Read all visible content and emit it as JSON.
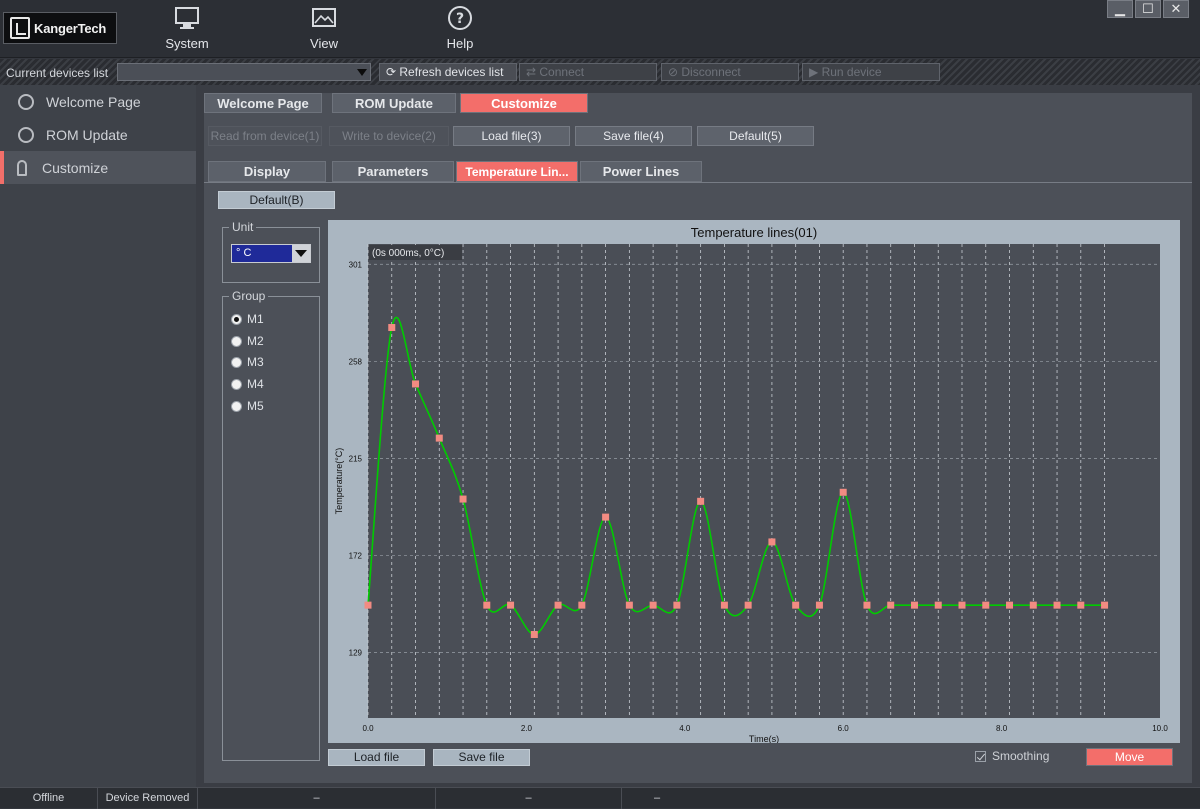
{
  "logo": {
    "text": "KangerTech"
  },
  "menu": [
    {
      "label": "System"
    },
    {
      "label": "View"
    },
    {
      "label": "Help"
    }
  ],
  "window": {
    "minimize": "▁",
    "maximize": "☐",
    "close": "✕"
  },
  "devices": {
    "label": "Current devices list",
    "selected": "",
    "refresh": "Refresh devices list",
    "connect": "Connect",
    "disconnect": "Disconnect",
    "run": "Run device"
  },
  "sidebar": {
    "items": [
      {
        "label": "Welcome Page",
        "icon": "smiley-icon"
      },
      {
        "label": "ROM Update",
        "icon": "upload-icon"
      },
      {
        "label": "Customize",
        "icon": "tool-icon"
      }
    ]
  },
  "tabs": {
    "welcome": "Welcome Page",
    "rom": "ROM Update",
    "customize": "Customize"
  },
  "toolbar": {
    "read": "Read from device(1)",
    "write": "Write to device(2)",
    "load": "Load file(3)",
    "save": "Save file(4)",
    "default": "Default(5)"
  },
  "subtabs": {
    "display": "Display",
    "parameters": "Parameters",
    "temperature": "Temperature Lin...",
    "power": "Power Lines"
  },
  "default_b": "Default(B)",
  "unit": {
    "title": "Unit",
    "value": "° C"
  },
  "group": {
    "title": "Group",
    "options": [
      "M1",
      "M2",
      "M3",
      "M4",
      "M5"
    ],
    "selected": "M1"
  },
  "buttons": {
    "load_file": "Load file",
    "save_file": "Save file",
    "smoothing": "Smoothing",
    "move": "Move"
  },
  "status": {
    "conn": "Offline",
    "device": "Device Removed",
    "dash1": "–",
    "dash2": "–",
    "dash3": "–"
  },
  "colors": {
    "accent": "#f36e6a",
    "line": "#00cc00",
    "marker": "#f28b82",
    "plot_bg": "#4a4e56"
  },
  "chart_data": {
    "type": "line",
    "title": "Temperature lines(01)",
    "readout": "(0s 000ms, 0°C)",
    "xlabel": "Time(s)",
    "ylabel": "Temperature(°C)",
    "xlim": [
      0,
      10
    ],
    "ylim": [
      100,
      310
    ],
    "x_ticks": [
      "0.0",
      "2.0",
      "4.0",
      "6.0",
      "8.0",
      "10.0"
    ],
    "y_ticks": [
      "129",
      "172",
      "215",
      "258",
      "301"
    ],
    "grid": true,
    "smoothing": true,
    "series": [
      {
        "x": [
          0.0,
          0.3,
          0.6,
          0.9,
          1.2,
          1.5,
          1.8,
          2.1,
          2.4,
          2.7,
          3.0,
          3.3,
          3.6,
          3.9,
          4.2,
          4.5,
          4.8,
          5.1,
          5.4,
          5.7,
          6.0,
          6.3,
          6.6,
          6.9,
          7.2,
          7.5,
          7.8,
          8.1,
          8.4,
          8.7,
          9.0,
          9.3
        ],
        "y": [
          150,
          273,
          248,
          224,
          197,
          150,
          150,
          137,
          150,
          150,
          189,
          150,
          150,
          150,
          196,
          150,
          150,
          178,
          150,
          150,
          200,
          150,
          150,
          150,
          150,
          150,
          150,
          150,
          150,
          150,
          150,
          150
        ]
      }
    ]
  }
}
